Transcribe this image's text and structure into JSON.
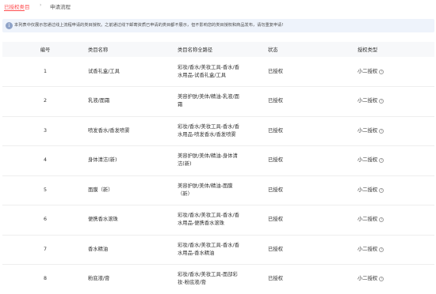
{
  "tabs": {
    "active_label": "已授权类目",
    "separator": "›",
    "inactive_label": "申请流程"
  },
  "notice": {
    "icon": "info-icon",
    "text": "本列表中仅展示您通过线上流程申请的类目授权。之前通过线下邮寄资质已申请的类目都不展示，但不影响您的类目授权和商品发布，请勿重复申请!"
  },
  "table": {
    "headers": [
      "编号",
      "类目名称",
      "类目名称全路径",
      "状态",
      "授权类型"
    ],
    "help_icon": "question-circle-icon",
    "rows": [
      {
        "num": "1",
        "name": "试香礼盒/工具",
        "path": "彩妆/香水/美妆工具-香水/香水用品-试香礼盒/工具",
        "status": "已授权",
        "type": "小二授权"
      },
      {
        "num": "2",
        "name": "乳液/面霜",
        "path": "美容护肤/美体/精油-乳液/面霜",
        "status": "已授权",
        "type": "小二授权"
      },
      {
        "num": "3",
        "name": "喷发香水/香发喷雾",
        "path": "彩妆/香水/美妆工具-香水/香水用品-喷发香水/香发喷雾",
        "status": "已授权",
        "type": "小二授权"
      },
      {
        "num": "4",
        "name": "身体清洁(新)",
        "path": "美容护肤/美体/精油-身体清洁(新)",
        "status": "已授权",
        "type": "小二授权"
      },
      {
        "num": "5",
        "name": "面膜（新）",
        "path": "美容护肤/美体/精油-面膜（新）",
        "status": "已授权",
        "type": "小二授权"
      },
      {
        "num": "6",
        "name": "便携香水滚珠",
        "path": "彩妆/香水/美妆工具-香水/香水用品-便携香水滚珠",
        "status": "已授权",
        "type": "小二授权"
      },
      {
        "num": "7",
        "name": "香水精油",
        "path": "彩妆/香水/美妆工具-香水/香水用品-香水精油",
        "status": "已授权",
        "type": "小二授权"
      },
      {
        "num": "8",
        "name": "粉底液/膏",
        "path": "彩妆/香水/美妆工具-面部彩妆-粉底液/膏",
        "status": "已授权",
        "type": "小二授权"
      }
    ]
  }
}
